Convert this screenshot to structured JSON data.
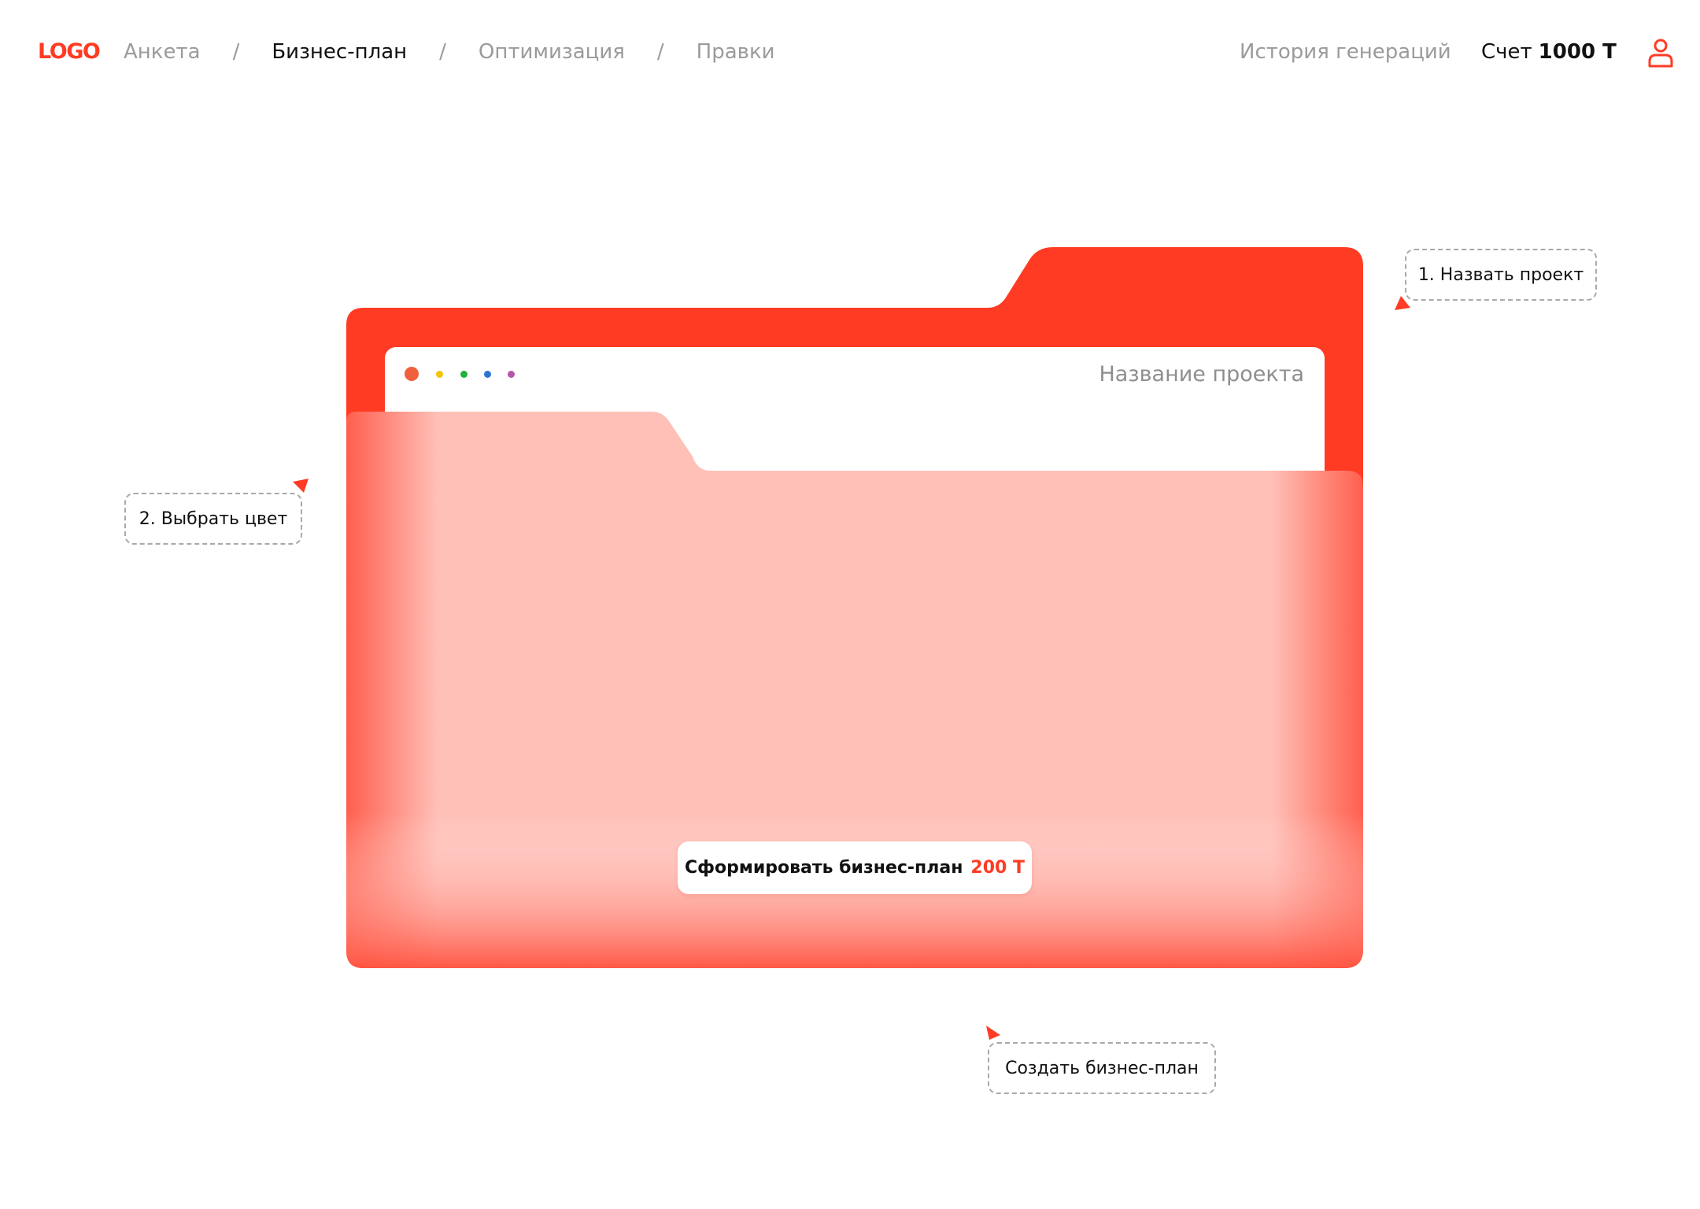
{
  "header": {
    "logo": "LOGO",
    "nav": {
      "items": [
        "Анкета",
        "Бизнес-план",
        "Оптимизация",
        "Правки"
      ],
      "active_index": 1,
      "separator": "/"
    },
    "history_link": "История генераций",
    "account_label": "Счет",
    "account_balance": "1000 Т",
    "user_icon": "user-icon"
  },
  "folder": {
    "color": "#ff3b24",
    "window_dots": [
      "#f1603c",
      "#f4c20d",
      "#1fb23a",
      "#2f74d0",
      "#b656a8"
    ],
    "project_name_placeholder": "Название проекта",
    "cta_label": "Сформировать бизнес-план",
    "cta_price": "200 Т"
  },
  "annotations": {
    "step1": "1. Назвать проект",
    "step2": "2. Выбрать цвет",
    "step3": "Создать бизнес-план"
  }
}
